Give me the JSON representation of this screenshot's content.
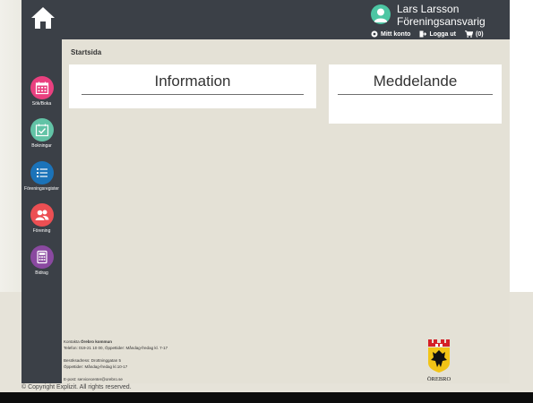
{
  "header": {
    "user_name": "Lars Larsson",
    "user_role": "Föreningsansvarig",
    "links": {
      "account": "Mitt konto",
      "logout": "Logga ut",
      "cart": "(0)"
    }
  },
  "sidebar": {
    "items": [
      {
        "label": "Sök/Boka",
        "icon": "calendar-icon",
        "color": "#e9407f"
      },
      {
        "label": "Bokningar",
        "icon": "calendar-check-icon",
        "color": "#62c3a6"
      },
      {
        "label": "Föreningsregister",
        "icon": "list-icon",
        "color": "#1b73b9"
      },
      {
        "label": "Förening",
        "icon": "users-icon",
        "color": "#ec4f53"
      },
      {
        "label": "Bidrag",
        "icon": "calculator-icon",
        "color": "#8a49a0"
      }
    ]
  },
  "breadcrumb": "Startsida",
  "panels": {
    "information": "Information",
    "meddelande": "Meddelande"
  },
  "footer": {
    "contact_prefix": "Kontakta ",
    "contact_org": "Örebro kommun",
    "phone": "Telefon: 019-21 10 00, Öppettider: Måndag-fredag kl. 7-17",
    "address": "Besöksadress: Drottninggatan 5",
    "hours": "Öppettider: Måndag-fredag kl.10-17",
    "email": "E-post: servicecenter@orebro.se",
    "copyright": "© Copyright Explizit. All rights reserved."
  },
  "crest": {
    "label": "ÖREBRO",
    "colors": {
      "tower": "#d42027",
      "shield": "#f2c416",
      "lion": "#111111"
    }
  },
  "colors": {
    "chrome": "#3b4047",
    "background": "#e4e1d6",
    "avatar": "#4cc6a3"
  }
}
